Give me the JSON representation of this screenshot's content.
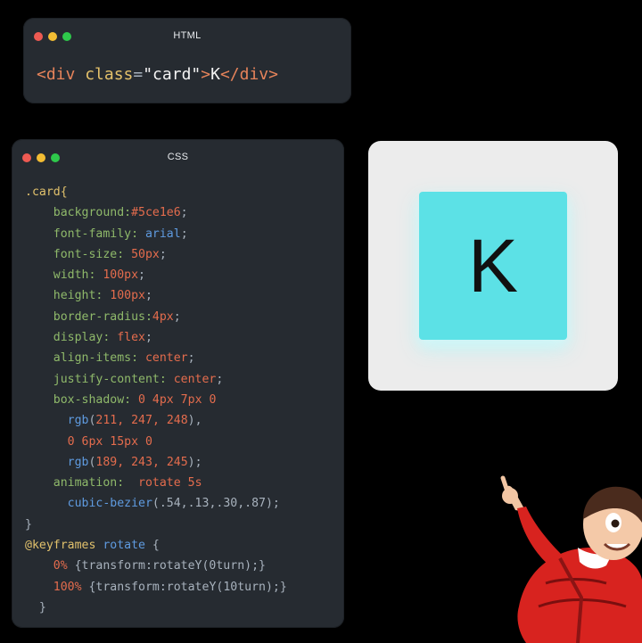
{
  "colors": {
    "dot_red": "#ee5a52",
    "dot_yellow": "#f3bd33",
    "dot_green": "#2ec94b",
    "tag": "#e6835a",
    "attr": "#e4c16a",
    "string": "#f3f3f3",
    "selector": "#e1c16c",
    "property": "#8fb96a",
    "value": "#e46c4d",
    "func": "#5f9be0",
    "keyword": "#e1c16c",
    "plain": "#a8b2bd",
    "card_bg": "#5ce1e6"
  },
  "html_window": {
    "title": "HTML",
    "code": [
      [
        {
          "t": "<div ",
          "c": "tag"
        },
        {
          "t": "class",
          "c": "attr"
        },
        {
          "t": "=",
          "c": "plain"
        },
        {
          "t": "\"card\"",
          "c": "string"
        },
        {
          "t": ">",
          "c": "tag"
        },
        {
          "t": "K",
          "c": "string"
        },
        {
          "t": "</div>",
          "c": "tag"
        }
      ]
    ]
  },
  "css_window": {
    "title": "CSS",
    "code": [
      [
        {
          "t": ".card{",
          "c": "selector"
        }
      ],
      [
        {
          "t": "    background:",
          "c": "property"
        },
        {
          "t": "#5ce1e6",
          "c": "value"
        },
        {
          "t": ";",
          "c": "plain"
        }
      ],
      [
        {
          "t": "    font-family: ",
          "c": "property"
        },
        {
          "t": "arial",
          "c": "func"
        },
        {
          "t": ";",
          "c": "plain"
        }
      ],
      [
        {
          "t": "    font-size: ",
          "c": "property"
        },
        {
          "t": "50px",
          "c": "value"
        },
        {
          "t": ";",
          "c": "plain"
        }
      ],
      [
        {
          "t": "    width: ",
          "c": "property"
        },
        {
          "t": "100px",
          "c": "value"
        },
        {
          "t": ";",
          "c": "plain"
        }
      ],
      [
        {
          "t": "    height: ",
          "c": "property"
        },
        {
          "t": "100px",
          "c": "value"
        },
        {
          "t": ";",
          "c": "plain"
        }
      ],
      [
        {
          "t": "    border-radius:",
          "c": "property"
        },
        {
          "t": "4px",
          "c": "value"
        },
        {
          "t": ";",
          "c": "plain"
        }
      ],
      [
        {
          "t": "    display: ",
          "c": "property"
        },
        {
          "t": "flex",
          "c": "value"
        },
        {
          "t": ";",
          "c": "plain"
        }
      ],
      [
        {
          "t": "    align-items: ",
          "c": "property"
        },
        {
          "t": "center",
          "c": "value"
        },
        {
          "t": ";",
          "c": "plain"
        }
      ],
      [
        {
          "t": "    justify-content: ",
          "c": "property"
        },
        {
          "t": "center",
          "c": "value"
        },
        {
          "t": ";",
          "c": "plain"
        }
      ],
      [
        {
          "t": "    box-shadow: ",
          "c": "property"
        },
        {
          "t": "0 4px 7px 0",
          "c": "value"
        }
      ],
      [
        {
          "t": "      rgb",
          "c": "func"
        },
        {
          "t": "(",
          "c": "plain"
        },
        {
          "t": "211, 247, 248",
          "c": "value"
        },
        {
          "t": "),",
          "c": "plain"
        }
      ],
      [
        {
          "t": "      0 6px 15px 0",
          "c": "value"
        }
      ],
      [
        {
          "t": "      rgb",
          "c": "func"
        },
        {
          "t": "(",
          "c": "plain"
        },
        {
          "t": "189, 243, 245",
          "c": "value"
        },
        {
          "t": ");",
          "c": "plain"
        }
      ],
      [
        {
          "t": "    animation:  ",
          "c": "property"
        },
        {
          "t": "rotate 5s",
          "c": "value"
        }
      ],
      [
        {
          "t": "      cubic-bezier",
          "c": "func"
        },
        {
          "t": "(.54,.13,.30,.87);",
          "c": "plain"
        }
      ],
      [
        {
          "t": "}",
          "c": "plain"
        }
      ],
      [
        {
          "t": "@keyframes ",
          "c": "keyword"
        },
        {
          "t": "rotate",
          "c": "func"
        },
        {
          "t": " {",
          "c": "plain"
        }
      ],
      [
        {
          "t": "    0% ",
          "c": "value"
        },
        {
          "t": "{transform:rotateY(0turn);}",
          "c": "plain"
        }
      ],
      [
        {
          "t": "    100% ",
          "c": "value"
        },
        {
          "t": "{transform:rotateY(10turn);}",
          "c": "plain"
        }
      ],
      [
        {
          "t": "  }",
          "c": "plain"
        }
      ]
    ]
  },
  "preview": {
    "card_letter": "K"
  },
  "mascot": {
    "icon": "cartoon-man-pointing-icon"
  }
}
